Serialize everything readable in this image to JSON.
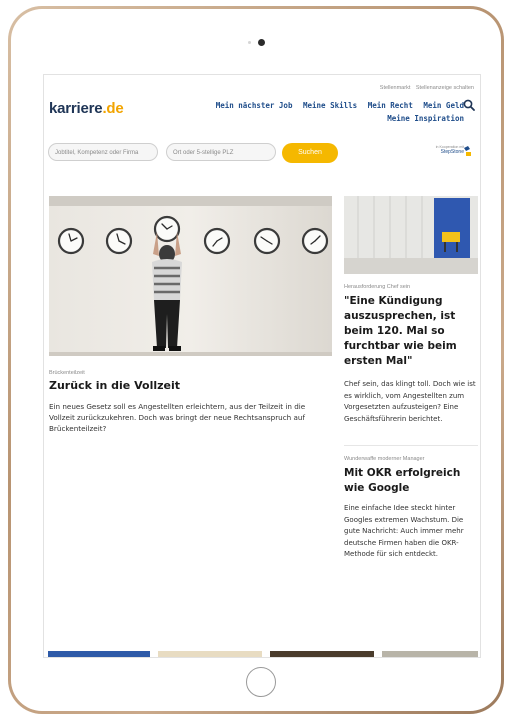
{
  "site": {
    "logo_text": "karriere",
    "logo_suffix": ".de",
    "top_links": [
      "Stellenmarkt",
      "Stellenanzeige schalten"
    ],
    "nav_row1": [
      "Mein nächster Job",
      "Meine Skills",
      "Mein Recht",
      "Mein Geld"
    ],
    "nav_row2": [
      "Meine Inspiration"
    ]
  },
  "search": {
    "job_placeholder": "Jobtitel, Kompetenz oder Firma",
    "location_placeholder": "Ort oder 5-stellige PLZ",
    "button_label": "Suchen",
    "partner_text": "in Kooperation mit",
    "partner_brand": "StepStone"
  },
  "main_article": {
    "kicker": "Brückenteilzeit",
    "headline": "Zurück in die Vollzeit",
    "teaser": "Ein neues Gesetz soll es Angestellten erleichtern, aus der Teilzeit in die Vollzeit zurückzukehren. Doch was bringt der neue Rechtsanspruch auf Brückenteilzeit?"
  },
  "side_articles": [
    {
      "kicker": "Herausforderung Chef sein",
      "headline": "\"Eine Kündigung auszusprechen, ist beim 120. Mal so furchtbar wie beim ersten Mal\"",
      "teaser": "Chef sein, das klingt toll. Doch wie ist es wirklich, vom Angestellten zum Vorgesetzten aufzusteigen? Eine Geschäftsführerin berichtet."
    },
    {
      "kicker": "Wunderwaffe moderner Manager",
      "headline": "Mit OKR erfolgreich wie Google",
      "teaser": "Eine einfache Idee steckt hinter Googles extremen Wachstum. Die gute Nachricht: Auch immer mehr deutsche Firmen haben die OKR-Methode für sich entdeckt."
    }
  ],
  "colors": {
    "brand_navy": "#1f3556",
    "nav_blue": "#1f4d8a",
    "accent_yellow": "#f5b800",
    "device_gold": "#c9a583"
  }
}
